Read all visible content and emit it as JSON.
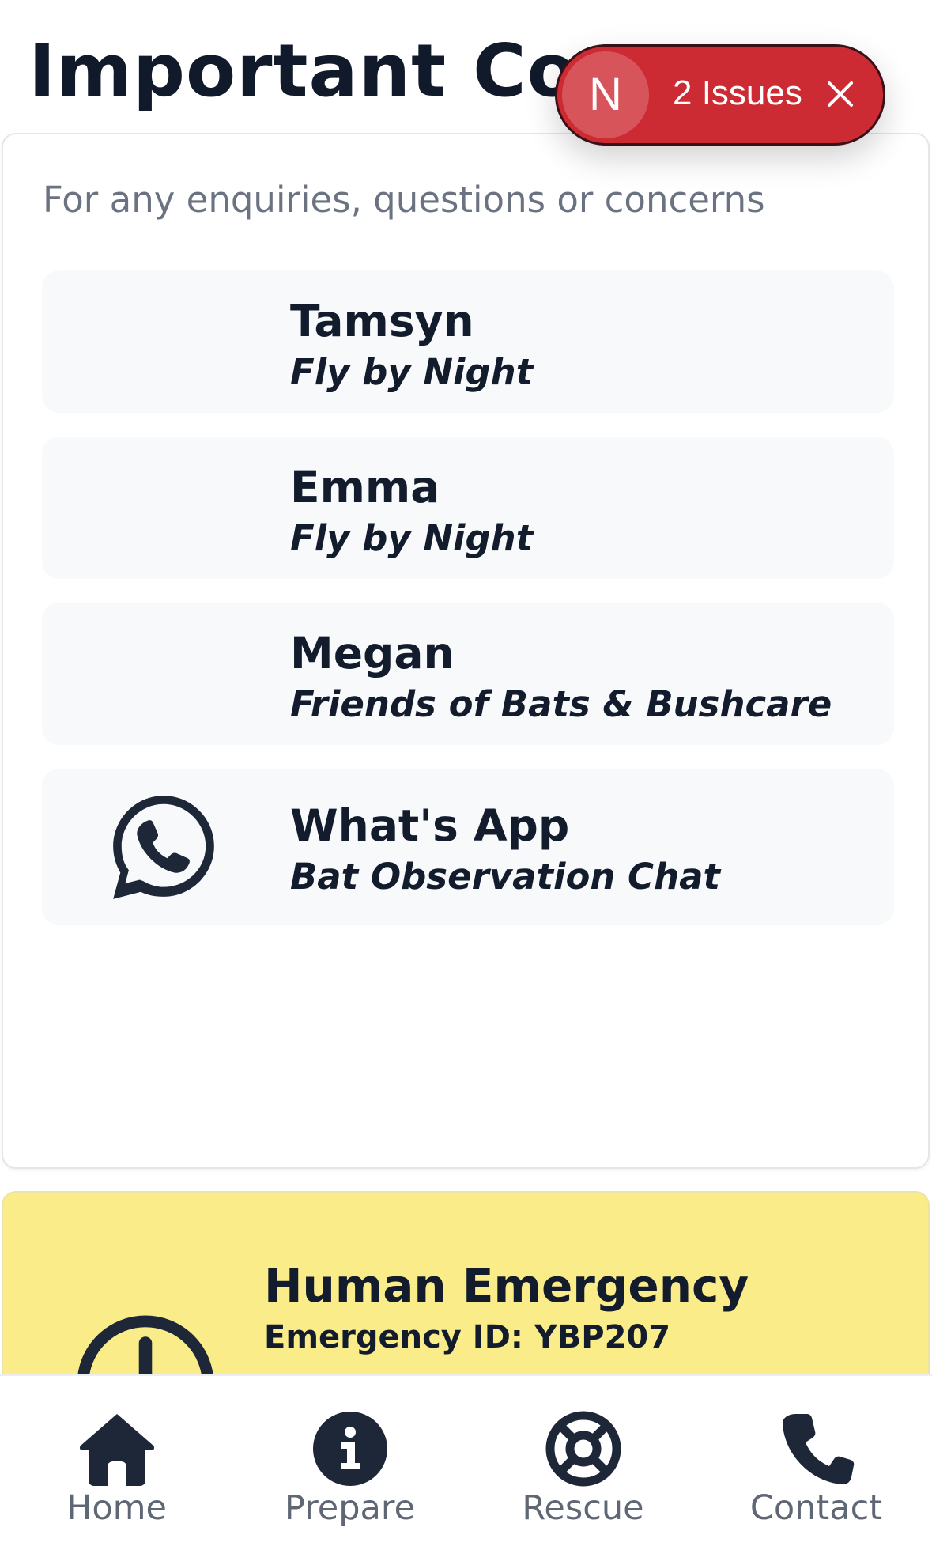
{
  "page": {
    "title": "Important Contacts"
  },
  "contacts_card": {
    "subtitle": "For any enquiries, questions or concerns",
    "items": [
      {
        "name": "Tamsyn",
        "org": "Fly by Night",
        "icon": "none"
      },
      {
        "name": "Emma",
        "org": "Fly by Night",
        "icon": "none"
      },
      {
        "name": "Megan",
        "org": "Friends of Bats & Bushcare",
        "icon": "none"
      },
      {
        "name": "What's App",
        "org": "Bat Observation Chat",
        "icon": "whatsapp-icon"
      }
    ]
  },
  "emergency_card": {
    "title": "Human Emergency",
    "emergency_id": "Emergency ID: YBP207",
    "icon": "alert-circle-icon"
  },
  "bottom_nav": {
    "items": [
      {
        "label": "Home",
        "icon": "home-icon"
      },
      {
        "label": "Prepare",
        "icon": "info-icon"
      },
      {
        "label": "Rescue",
        "icon": "lifebuoy-icon"
      },
      {
        "label": "Contact",
        "icon": "phone-icon"
      }
    ]
  },
  "dev_overlay": {
    "logo_letter": "N",
    "issues_label": "2 Issues"
  },
  "colors": {
    "text": "#131c2d",
    "muted": "#6b7382",
    "item_bg": "#f8f9fb",
    "emergency_bg": "#fbec8a",
    "toast_bg": "#cc2b34"
  }
}
